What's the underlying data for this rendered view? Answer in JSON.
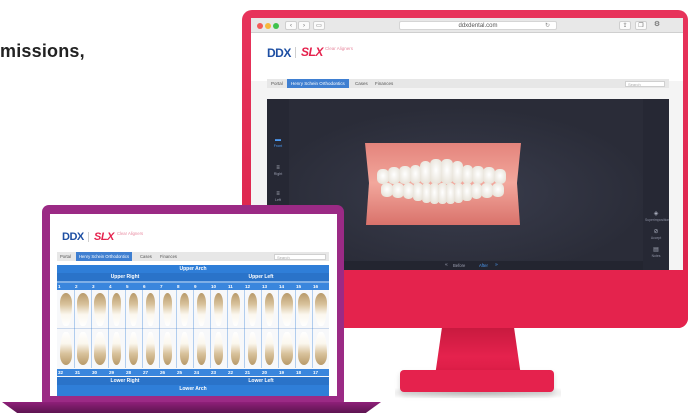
{
  "headline": "missions,",
  "desktop": {
    "browser": {
      "url": "ddxdental.com",
      "back_icon": "chevron-left-icon",
      "forward_icon": "chevron-right-icon",
      "sidebar_icon": "sidebar-icon",
      "reload_icon": "reload-icon"
    },
    "logo": {
      "ddx": "DDX",
      "slx": "SLX",
      "sub": "Clear Aligners"
    },
    "tabs": [
      "Portal",
      "Henry Schein Orthodontics",
      "Cases",
      "Finances"
    ],
    "active_tab": "Henry Schein Orthodontics",
    "search_placeholder": "Search",
    "viewer": {
      "left_tools": [
        {
          "label": "Front",
          "icon": "front-view-icon",
          "active": true
        },
        {
          "label": "Right",
          "icon": "right-view-icon",
          "active": false
        },
        {
          "label": "Left",
          "icon": "left-view-icon",
          "active": false
        }
      ],
      "right_tools": [
        {
          "label": "Superimposition",
          "icon": "layers-icon"
        },
        {
          "label": "Accept",
          "icon": "check-circle-icon"
        },
        {
          "label": "Notes",
          "icon": "notes-icon"
        }
      ],
      "before_label": "Before",
      "after_label": "After"
    }
  },
  "laptop": {
    "logo": {
      "ddx": "DDX",
      "slx": "SLX",
      "sub": "Clear Aligners"
    },
    "tabs": [
      "Portal",
      "Henry Schein Orthodontics",
      "Cases",
      "Finances"
    ],
    "active_tab": "Henry Schein Orthodontics",
    "search_placeholder": "Search",
    "chart": {
      "upper_arch": "Upper Arch",
      "lower_arch": "Lower Arch",
      "upper_right": "Upper Right",
      "upper_left": "Upper Left",
      "lower_right": "Lower Right",
      "lower_left": "Lower Left",
      "upper_numbers": [
        "1",
        "2",
        "3",
        "4",
        "5",
        "6",
        "7",
        "8",
        "9",
        "10",
        "11",
        "12",
        "13",
        "14",
        "15",
        "16"
      ],
      "lower_numbers": [
        "32",
        "31",
        "30",
        "29",
        "28",
        "27",
        "26",
        "25",
        "24",
        "23",
        "22",
        "21",
        "20",
        "19",
        "18",
        "17"
      ]
    }
  }
}
